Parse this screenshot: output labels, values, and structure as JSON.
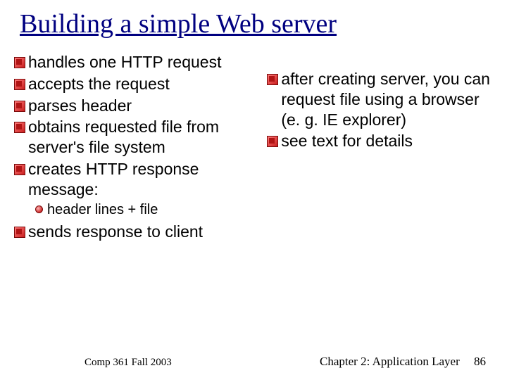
{
  "title": "Building a simple Web server",
  "left_bullets": [
    "handles one HTTP request",
    "accepts the request",
    "parses header",
    "obtains requested file from server's file system",
    "creates HTTP response message:"
  ],
  "left_sub": "header lines + file",
  "left_bullets_2": [
    "sends response to client"
  ],
  "right_bullets": [
    "after creating server, you can request file using a browser (e. g. IE explorer)",
    "see  text for details"
  ],
  "footer_left": "Comp 361   Fall 2003",
  "footer_right_label": "Chapter 2: Application Layer",
  "footer_right_page": "86"
}
